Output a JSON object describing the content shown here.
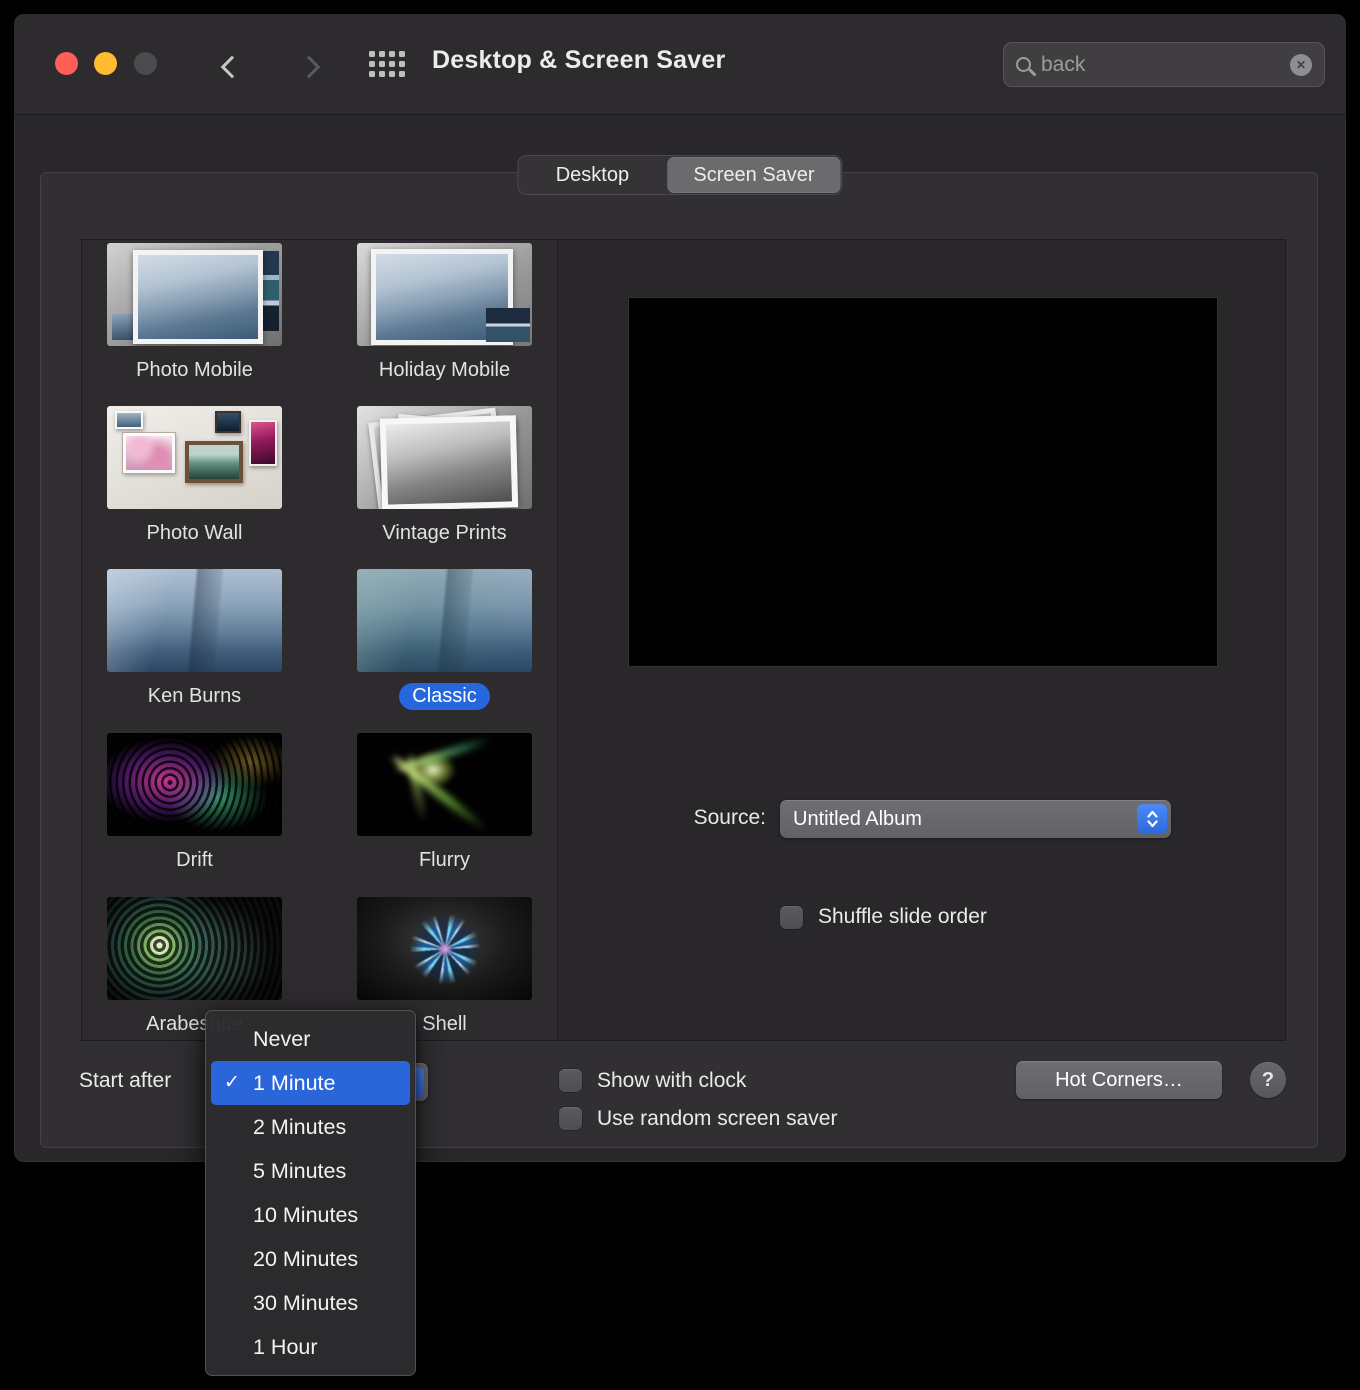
{
  "window": {
    "title": "Desktop & Screen Saver",
    "search": {
      "value": "back"
    }
  },
  "tabs": [
    {
      "label": "Desktop",
      "selected": false
    },
    {
      "label": "Screen Saver",
      "selected": true
    }
  ],
  "savers": [
    {
      "name": "Photo Mobile"
    },
    {
      "name": "Holiday Mobile"
    },
    {
      "name": "Photo Wall"
    },
    {
      "name": "Vintage Prints"
    },
    {
      "name": "Ken Burns"
    },
    {
      "name": "Classic",
      "selected": true
    },
    {
      "name": "Drift"
    },
    {
      "name": "Flurry"
    },
    {
      "name": "Arabesque"
    },
    {
      "name": "Shell"
    }
  ],
  "source": {
    "label": "Source:",
    "value": "Untitled Album"
  },
  "shuffle_label": "Shuffle slide order",
  "bottom": {
    "start_after_label": "Start after",
    "show_with_clock_label": "Show with clock",
    "use_random_label": "Use random screen saver",
    "hot_corners_label": "Hot Corners…",
    "help_label": "?"
  },
  "menu": {
    "checkmark": "✓",
    "selected_item": "1 Minute",
    "items": [
      "Never",
      "1 Minute",
      "2 Minutes",
      "5 Minutes",
      "10 Minutes",
      "20 Minutes",
      "30 Minutes",
      "1 Hour"
    ]
  },
  "colors": {
    "accent_blue": "#2a65d9",
    "selected_label_blue": "#2667de",
    "window_background": "#29272a"
  }
}
